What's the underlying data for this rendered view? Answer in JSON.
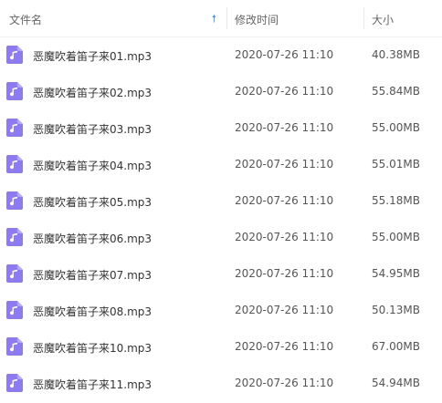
{
  "colors": {
    "icon_bg": "#8c7cf0",
    "sort_arrow": "#3b8cf0"
  },
  "header": {
    "name_label": "文件名",
    "sort_icon": "sort-up-arrow-icon",
    "date_label": "修改时间",
    "size_label": "大小"
  },
  "files": [
    {
      "name": "恶魔吹着笛子来01.mp3",
      "date": "2020-07-26 11:10",
      "size": "40.38MB",
      "icon": "music-file-icon"
    },
    {
      "name": "恶魔吹着笛子来02.mp3",
      "date": "2020-07-26 11:10",
      "size": "55.84MB",
      "icon": "music-file-icon"
    },
    {
      "name": "恶魔吹着笛子来03.mp3",
      "date": "2020-07-26 11:10",
      "size": "55.00MB",
      "icon": "music-file-icon"
    },
    {
      "name": "恶魔吹着笛子来04.mp3",
      "date": "2020-07-26 11:10",
      "size": "55.01MB",
      "icon": "music-file-icon"
    },
    {
      "name": "恶魔吹着笛子来05.mp3",
      "date": "2020-07-26 11:10",
      "size": "55.18MB",
      "icon": "music-file-icon"
    },
    {
      "name": "恶魔吹着笛子来06.mp3",
      "date": "2020-07-26 11:10",
      "size": "55.00MB",
      "icon": "music-file-icon"
    },
    {
      "name": "恶魔吹着笛子来07.mp3",
      "date": "2020-07-26 11:10",
      "size": "54.95MB",
      "icon": "music-file-icon"
    },
    {
      "name": "恶魔吹着笛子来08.mp3",
      "date": "2020-07-26 11:10",
      "size": "50.13MB",
      "icon": "music-file-icon"
    },
    {
      "name": "恶魔吹着笛子来10.mp3",
      "date": "2020-07-26 11:10",
      "size": "67.00MB",
      "icon": "music-file-icon"
    },
    {
      "name": "恶魔吹着笛子来11.mp3",
      "date": "2020-07-26 11:10",
      "size": "54.94MB",
      "icon": "music-file-icon"
    }
  ]
}
